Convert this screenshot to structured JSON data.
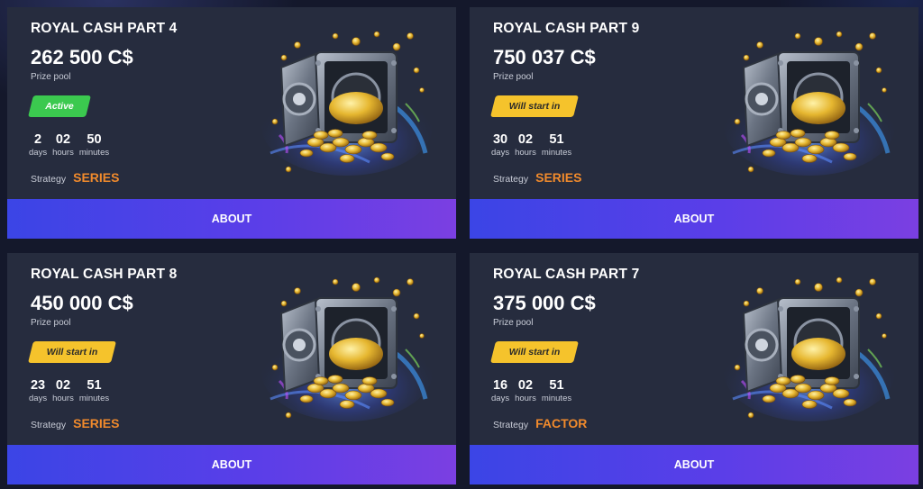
{
  "colors": {
    "card_bg": "#262c3e",
    "active_badge": "#3bc94f",
    "pending_badge": "#f5c32c",
    "strategy_accent": "#f08a2c",
    "button_start": "#3b45e6",
    "button_end": "#7b3fe2"
  },
  "cards": [
    {
      "title": "ROYAL CASH PART 4",
      "prize": "262 500 C$",
      "prize_label": "Prize pool",
      "status": "Active",
      "status_color": "green",
      "timer": [
        {
          "value": "2",
          "label": "days"
        },
        {
          "value": "02",
          "label": "hours"
        },
        {
          "value": "50",
          "label": "minutes"
        }
      ],
      "strategy_label": "Strategy",
      "strategy": "SERIES",
      "button": "ABOUT",
      "icon": "vault-gold-coins-image"
    },
    {
      "title": "ROYAL CASH PART 9",
      "prize": "750 037 C$",
      "prize_label": "Prize pool",
      "status": "Will start in",
      "status_color": "yellow",
      "timer": [
        {
          "value": "30",
          "label": "days"
        },
        {
          "value": "02",
          "label": "hours"
        },
        {
          "value": "51",
          "label": "minutes"
        }
      ],
      "strategy_label": "Strategy",
      "strategy": "SERIES",
      "button": "ABOUT",
      "icon": "vault-gold-coins-image"
    },
    {
      "title": "ROYAL CASH PART 8",
      "prize": "450 000 C$",
      "prize_label": "Prize pool",
      "status": "Will start in",
      "status_color": "yellow",
      "timer": [
        {
          "value": "23",
          "label": "days"
        },
        {
          "value": "02",
          "label": "hours"
        },
        {
          "value": "51",
          "label": "minutes"
        }
      ],
      "strategy_label": "Strategy",
      "strategy": "SERIES",
      "button": "ABOUT",
      "icon": "vault-gold-coins-image"
    },
    {
      "title": "ROYAL CASH PART 7",
      "prize": "375 000 C$",
      "prize_label": "Prize pool",
      "status": "Will start in",
      "status_color": "yellow",
      "timer": [
        {
          "value": "16",
          "label": "days"
        },
        {
          "value": "02",
          "label": "hours"
        },
        {
          "value": "51",
          "label": "minutes"
        }
      ],
      "strategy_label": "Strategy",
      "strategy": "FACTOR",
      "button": "ABOUT",
      "icon": "vault-gold-coins-image"
    }
  ]
}
